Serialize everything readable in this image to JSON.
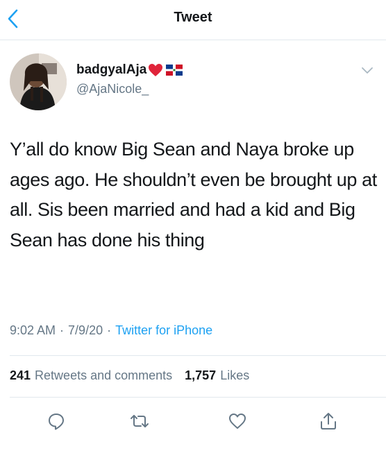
{
  "header": {
    "title": "Tweet"
  },
  "author": {
    "name": "badgyalAja",
    "handle": "@AjaNicole_"
  },
  "tweet": {
    "text": "Y’all do know Big Sean and Naya broke up ages ago. He shouldn’t even be brought up at all. Sis been married and had a kid and Big Sean has done his thing",
    "time": "9:02 AM",
    "date": "7/9/20",
    "separator": "·",
    "source": "Twitter for iPhone"
  },
  "stats": {
    "retweets_count": "241",
    "retweets_label": "Retweets and comments",
    "likes_count": "1,757",
    "likes_label": "Likes"
  },
  "icons": {
    "back": "chevron-left-icon",
    "heart_emoji": "red-heart-emoji",
    "flag_emoji": "dominican-republic-flag-emoji",
    "caret": "chevron-down-icon",
    "reply": "reply-icon",
    "retweet": "retweet-icon",
    "like": "like-icon",
    "share": "share-icon"
  },
  "colors": {
    "accent": "#1da1f2",
    "text": "#14171a",
    "secondary": "#657786",
    "divider": "#e1e8ed"
  }
}
